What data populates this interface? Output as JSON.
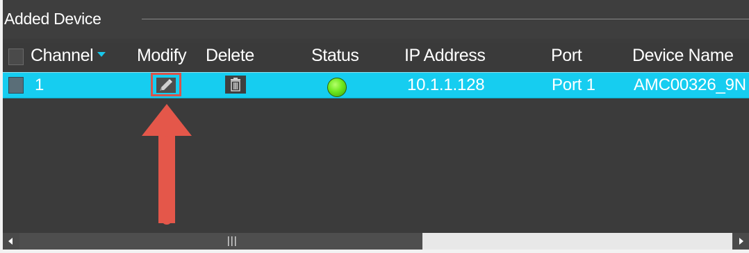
{
  "panel": {
    "title": "Added Device"
  },
  "table": {
    "columns": {
      "channel": "Channel",
      "modify": "Modify",
      "delete": "Delete",
      "status": "Status",
      "ip": "IP Address",
      "port": "Port",
      "device_name": "Device Name"
    },
    "rows": [
      {
        "channel": "1",
        "status": "online",
        "ip": "10.1.1.128",
        "port": "Port 1",
        "device_name": "AMC00326_9N"
      }
    ]
  },
  "icons": {
    "modify": "pencil-icon",
    "delete": "trash-icon",
    "status": "green-status-dot",
    "sort": "caret-down-icon",
    "annotation": "red-up-arrow"
  },
  "colors": {
    "selected_row": "#16cdf0",
    "background": "#3b3b3b",
    "status_online": "#6ee81f",
    "annotation": "#d9534a"
  }
}
